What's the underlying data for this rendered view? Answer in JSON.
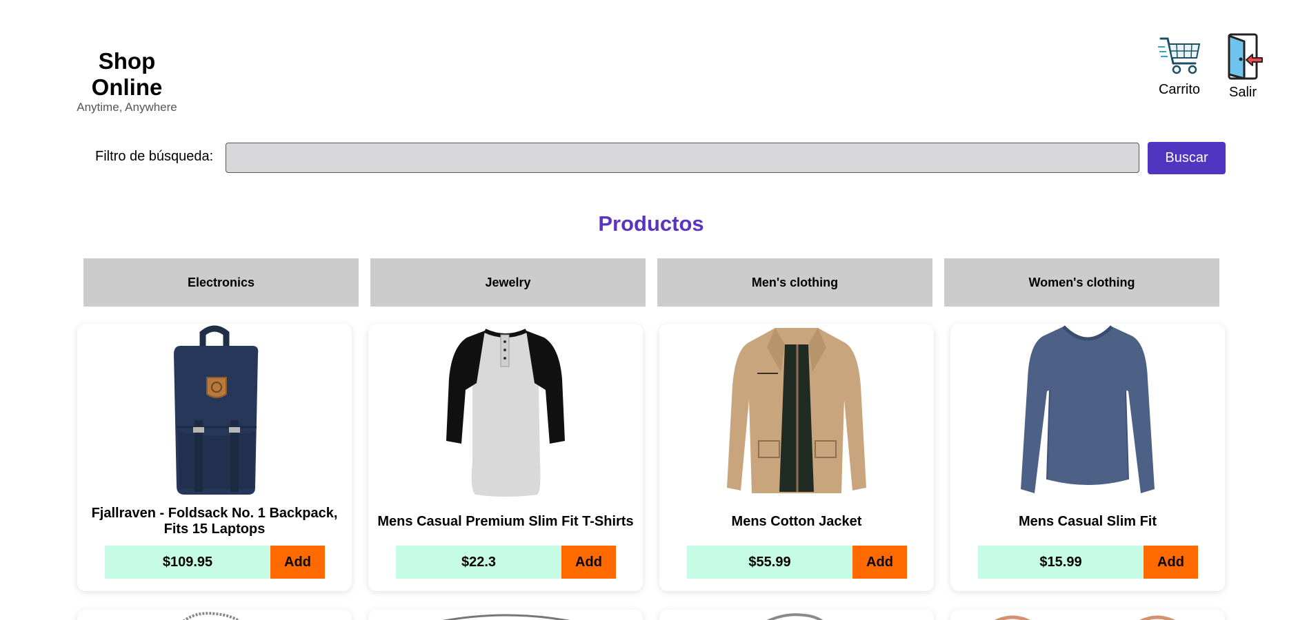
{
  "header": {
    "title": "Shop Online",
    "subtitle": "Anytime, Anywhere",
    "cart": {
      "label": "Carrito",
      "icon": "shopping-cart-icon"
    },
    "logout": {
      "label": "Salir",
      "icon": "exit-door-icon"
    }
  },
  "search": {
    "label": "Filtro de búsqueda:",
    "value": "",
    "button_label": "Buscar"
  },
  "section_title": "Productos",
  "categories": [
    "Electronics",
    "Jewelry",
    "Men's clothing",
    "Women's clothing"
  ],
  "products": [
    {
      "title": "Fjallraven - Foldsack No. 1 Backpack, Fits 15 Laptops",
      "price": "$109.95",
      "add_label": "Add",
      "image": "backpack-image"
    },
    {
      "title": "Mens Casual Premium Slim Fit T-Shirts",
      "price": "$22.3",
      "add_label": "Add",
      "image": "raglan-tshirt-image"
    },
    {
      "title": "Mens Cotton Jacket",
      "price": "$55.99",
      "add_label": "Add",
      "image": "cotton-jacket-image"
    },
    {
      "title": "Mens Casual Slim Fit",
      "price": "$15.99",
      "add_label": "Add",
      "image": "longsleeve-shirt-image"
    }
  ],
  "colors": {
    "accent": "#4f36c0",
    "section_title": "#5a34c0",
    "add_button": "#ff6a00",
    "price_bg": "#c6fbe5",
    "category_bg": "#cccccc",
    "search_bg": "#d8d7d9"
  }
}
